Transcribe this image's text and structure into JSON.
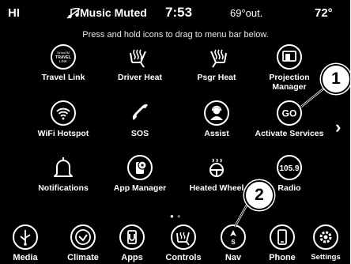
{
  "status": {
    "left": "HI",
    "music": "Music Muted",
    "time": "7:53",
    "outside": "69°out.",
    "right": "72°"
  },
  "hint": "Press and hold icons to drag to menu bar below.",
  "apps": [
    {
      "label": "Travel Link",
      "icon": "travel-link-icon",
      "icon_text": "SiriusXM TRAVEL LINK"
    },
    {
      "label": "Driver Heat",
      "icon": "driver-heat-icon"
    },
    {
      "label": "Psgr Heat",
      "icon": "passenger-heat-icon"
    },
    {
      "label": "Projection Manager",
      "icon": "projection-manager-icon"
    },
    {
      "label": "WiFi Hotspot",
      "icon": "wifi-icon"
    },
    {
      "label": "SOS",
      "icon": "phone-sos-icon"
    },
    {
      "label": "Assist",
      "icon": "assist-icon"
    },
    {
      "label": "Activate Services",
      "icon": "activate-services-icon",
      "icon_text": "GO"
    },
    {
      "label": "Notifications",
      "icon": "bell-icon"
    },
    {
      "label": "App Manager",
      "icon": "app-manager-icon"
    },
    {
      "label": "Heated Wheel",
      "icon": "heated-wheel-icon"
    },
    {
      "label": "Radio",
      "icon": "radio-icon",
      "icon_text": "105.9"
    }
  ],
  "bottom_bar": [
    {
      "label": "Media",
      "icon": "usb-icon"
    },
    {
      "label": "Climate",
      "icon": "climate-icon"
    },
    {
      "label": "Apps",
      "icon": "apps-icon"
    },
    {
      "label": "Controls",
      "icon": "controls-icon"
    },
    {
      "label": "Nav",
      "icon": "nav-icon"
    },
    {
      "label": "Phone",
      "icon": "phone-icon"
    },
    {
      "label": "Settings",
      "icon": "settings-icon"
    }
  ],
  "callouts": [
    "1",
    "2"
  ],
  "next_arrow": "›",
  "colors": {
    "background": "#000000",
    "text": "#ffffff",
    "edge": "#ffffff"
  }
}
